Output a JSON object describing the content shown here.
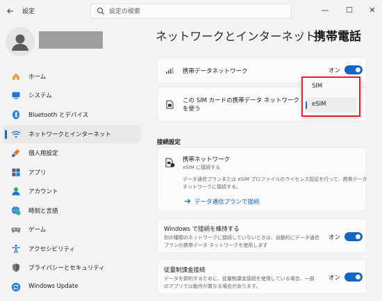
{
  "window": {
    "app_title": "設定",
    "back_icon": "back-arrow-icon",
    "minimize_glyph": "—",
    "maximize_glyph": "☐",
    "close_glyph": "✕"
  },
  "search": {
    "placeholder": "設定の検索"
  },
  "sidebar": {
    "items": [
      {
        "label": "ホーム",
        "icon": "home-icon"
      },
      {
        "label": "システム",
        "icon": "system-icon"
      },
      {
        "label": "Bluetooth とデバイス",
        "icon": "bluetooth-icon"
      },
      {
        "label": "ネットワークとインターネット",
        "icon": "wifi-icon",
        "active": true
      },
      {
        "label": "個人用設定",
        "icon": "brush-icon"
      },
      {
        "label": "アプリ",
        "icon": "apps-icon"
      },
      {
        "label": "アカウント",
        "icon": "account-icon"
      },
      {
        "label": "時刻と言語",
        "icon": "globe-clock-icon"
      },
      {
        "label": "ゲーム",
        "icon": "gamepad-icon"
      },
      {
        "label": "アクセシビリティ",
        "icon": "accessibility-icon"
      },
      {
        "label": "プライバシーとセキュリティ",
        "icon": "shield-icon"
      },
      {
        "label": "Windows Update",
        "icon": "update-icon"
      }
    ]
  },
  "breadcrumb": {
    "parent": "ネットワークとインターネット",
    "separator": "›",
    "current": "携帯電話"
  },
  "main": {
    "mobile_data_network": {
      "title": "携帯データネットワーク",
      "toggle_label": "オン"
    },
    "sim_card": {
      "title_line1": "この SIM カードの携帯データ ネットワーク",
      "title_line2": "を使う"
    },
    "dropdown": {
      "options": [
        "SIM",
        "eSIM"
      ],
      "selected": "eSIM"
    },
    "section_connection": "接続設定",
    "carrier_network": {
      "title": "携帯ネットワーク",
      "subtitle": "eSIM に接続する",
      "desc_line1": "データ通信プランまたは eSIM プロファイルのライセンス認証を行って、携帯データ",
      "desc_line2": "ネットワークに接続する。",
      "link": "データ通信プランで接続"
    },
    "keep_connected": {
      "title": "Windows で接続を維持する",
      "desc_line1": "別の種類のネットワークに接続していないときは、自動的にデータ通信",
      "desc_line2": "プランの携帯データ ネットワークを使用します",
      "toggle_label": "オン"
    },
    "metered": {
      "title": "従量制課金接続",
      "desc_line1": "データを節約するために、従量制課金接続を使用している場合、一部",
      "desc_line2": "のアプリでは動作が異なる場合があります。",
      "toggle_label": "オン"
    }
  },
  "colors": {
    "accent": "#1467c5",
    "highlight_border": "#e0202a"
  }
}
